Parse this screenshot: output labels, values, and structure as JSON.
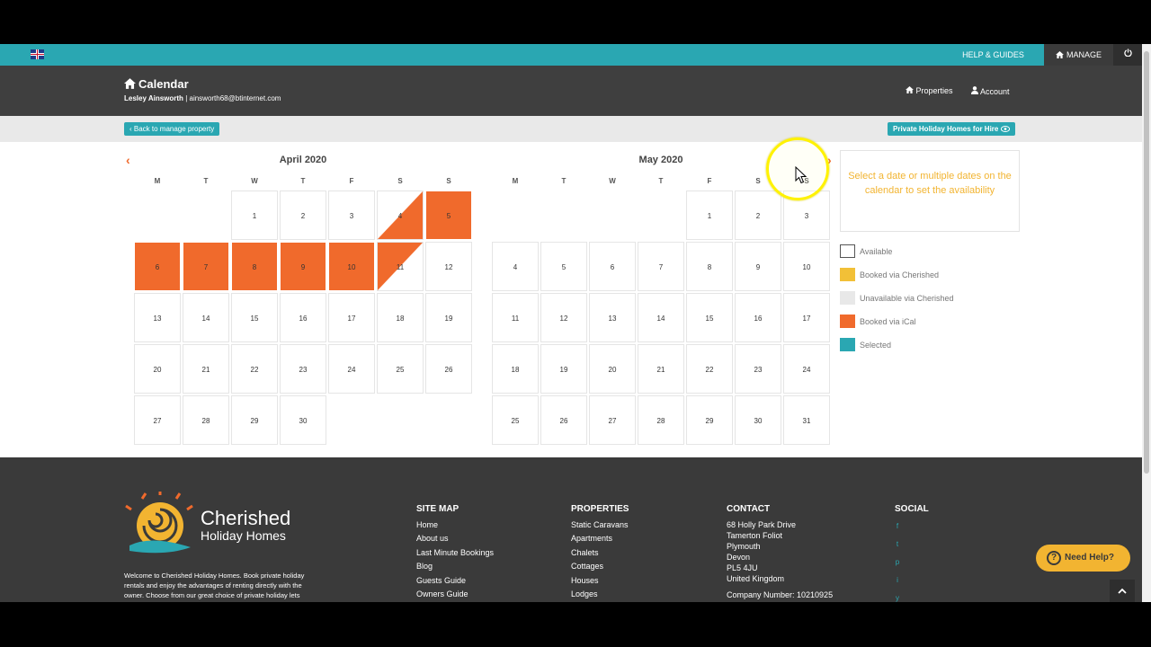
{
  "topbar": {
    "flag_icon": "uk-flag-icon",
    "help_label": "HELP & GUIDES",
    "manage_label": "MANAGE",
    "power_icon": "power-icon"
  },
  "header": {
    "title": "Calendar",
    "user_name": "Lesley Ainsworth",
    "user_email": "| ainsworth68@btinternet.com",
    "nav_properties": "Properties",
    "nav_account": "Account"
  },
  "toolbar": {
    "back_label": "‹ Back to manage property",
    "hire_label": "Private Holiday Homes for Hire"
  },
  "calendar": {
    "weekdays": [
      "M",
      "T",
      "W",
      "T",
      "F",
      "S",
      "S"
    ],
    "months": [
      {
        "title": "April 2020",
        "first_weekday": 2,
        "days": 30,
        "booked": [
          5,
          6,
          7,
          8,
          9,
          10
        ],
        "half_start": [
          4
        ],
        "half_end": [
          11
        ]
      },
      {
        "title": "May 2020",
        "first_weekday": 4,
        "days": 31,
        "booked": [],
        "half_start": [],
        "half_end": []
      }
    ]
  },
  "info_text": "Select a date or multiple dates on the calendar to set the availability",
  "legend": [
    {
      "label": "Available",
      "color": "#ffffff"
    },
    {
      "label": "Booked via Cherished",
      "color": "#f2c037"
    },
    {
      "label": "Unavailable via Cherished",
      "color": "#e8e8e8"
    },
    {
      "label": "Booked via iCal",
      "color": "#f06a2c"
    },
    {
      "label": "Selected",
      "color": "#2aa7b2"
    }
  ],
  "footer": {
    "logo_line1": "Cherished",
    "logo_line2": "Holiday Homes",
    "blurb": "Welcome to Cherished Holiday Homes. Book private holiday rentals and enjoy the advantages of renting directly with the owner. Choose from our great choice of private holiday lets",
    "sitemap_head": "SITE MAP",
    "sitemap": [
      "Home",
      "About us",
      "Last Minute Bookings",
      "Blog",
      "Guests Guide",
      "Owners Guide"
    ],
    "properties_head": "PROPERTIES",
    "properties": [
      "Static Caravans",
      "Apartments",
      "Chalets",
      "Cottages",
      "Houses",
      "Lodges"
    ],
    "contact_head": "CONTACT",
    "contact": [
      "68 Holly Park Drive",
      "Tamerton Foliot",
      "Plymouth",
      "Devon",
      "PL5 4JU",
      "United Kingdom"
    ],
    "company_number": "Company Number: 10210925",
    "social_head": "SOCIAL",
    "social": [
      "f",
      "t",
      "p",
      "i",
      "y"
    ],
    "need_help": "Need Help?"
  }
}
